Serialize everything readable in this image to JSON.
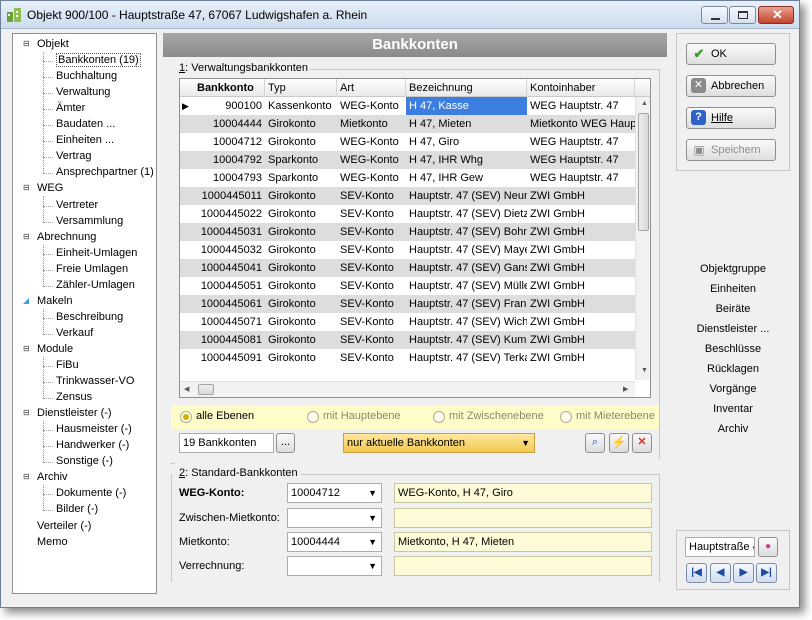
{
  "window": {
    "title": "Objekt 900/100 - Hauptstraße 47, 67067 Ludwigshafen a. Rhein",
    "min_icon": "minimize-icon",
    "max_icon": "maximize-icon",
    "close_icon": "close-icon"
  },
  "tree": [
    {
      "label": "Objekt",
      "level": 0,
      "icon": "minus"
    },
    {
      "label": "Bankkonten (19)",
      "level": 1,
      "selected": true
    },
    {
      "label": "Buchhaltung",
      "level": 1
    },
    {
      "label": "Verwaltung",
      "level": 1
    },
    {
      "label": "Ämter",
      "level": 1
    },
    {
      "label": "Baudaten ...",
      "level": 1
    },
    {
      "label": "Einheiten ...",
      "level": 1
    },
    {
      "label": "Vertrag",
      "level": 1
    },
    {
      "label": "Ansprechpartner (1)",
      "level": 1
    },
    {
      "label": "WEG",
      "level": 0,
      "icon": "minus"
    },
    {
      "label": "Vertreter",
      "level": 1
    },
    {
      "label": "Versammlung",
      "level": 1
    },
    {
      "label": "Abrechnung",
      "level": 0,
      "icon": "minus"
    },
    {
      "label": "Einheit-Umlagen",
      "level": 1
    },
    {
      "label": "Freie Umlagen",
      "level": 1
    },
    {
      "label": "Zähler-Umlagen",
      "level": 1
    },
    {
      "label": "Makeln",
      "level": 0,
      "icon": "open"
    },
    {
      "label": "Beschreibung",
      "level": 1
    },
    {
      "label": "Verkauf",
      "level": 1
    },
    {
      "label": "Module",
      "level": 0,
      "icon": "minus"
    },
    {
      "label": "FiBu",
      "level": 1
    },
    {
      "label": "Trinkwasser-VO",
      "level": 1
    },
    {
      "label": "Zensus",
      "level": 1
    },
    {
      "label": "Dienstleister (-)",
      "level": 0,
      "icon": "minus"
    },
    {
      "label": "Hausmeister (-)",
      "level": 1
    },
    {
      "label": "Handwerker (-)",
      "level": 1
    },
    {
      "label": "Sonstige (-)",
      "level": 1
    },
    {
      "label": "Archiv",
      "level": 0,
      "icon": "minus"
    },
    {
      "label": "Dokumente (-)",
      "level": 1
    },
    {
      "label": "Bilder (-)",
      "level": 1
    },
    {
      "label": "Verteiler (-)",
      "level": 0
    },
    {
      "label": "Memo",
      "level": 0
    }
  ],
  "main": {
    "title": "Bankkonten",
    "section1_num": "1",
    "section1_label": ": Verwaltungsbankkonten",
    "section2_num": "2",
    "section2_label": ": Standard-Bankkonten"
  },
  "grid": {
    "columns": [
      "Bankkonto",
      "Typ",
      "Art",
      "Bezeichnung",
      "Kontoinhaber"
    ],
    "rows": [
      [
        "900100",
        "Kassenkonto",
        "WEG-Konto",
        "H 47, Kasse",
        "WEG Hauptstr. 47"
      ],
      [
        "10004444",
        "Girokonto",
        "Mietkonto",
        "H 47, Mieten",
        "Mietkonto WEG Haup"
      ],
      [
        "10004712",
        "Girokonto",
        "WEG-Konto",
        "H 47, Giro",
        "WEG Hauptstr. 47"
      ],
      [
        "10004792",
        "Sparkonto",
        "WEG-Konto",
        "H 47, IHR Whg",
        "WEG Hauptstr. 47"
      ],
      [
        "10004793",
        "Sparkonto",
        "WEG-Konto",
        "H 47, IHR Gew",
        "WEG Hauptstr. 47"
      ],
      [
        "1000445011",
        "Girokonto",
        "SEV-Konto",
        "Hauptstr. 47 (SEV) Neum",
        "ZWI GmbH"
      ],
      [
        "1000445022",
        "Girokonto",
        "SEV-Konto",
        "Hauptstr. 47 (SEV) Dietz",
        "ZWI GmbH"
      ],
      [
        "1000445031",
        "Girokonto",
        "SEV-Konto",
        "Hauptstr. 47 (SEV) Bohn",
        "ZWI GmbH"
      ],
      [
        "1000445032",
        "Girokonto",
        "SEV-Konto",
        "Hauptstr. 47 (SEV) Maye",
        "ZWI GmbH"
      ],
      [
        "1000445041",
        "Girokonto",
        "SEV-Konto",
        "Hauptstr. 47 (SEV) Gans",
        "ZWI GmbH"
      ],
      [
        "1000445051",
        "Girokonto",
        "SEV-Konto",
        "Hauptstr. 47 (SEV) Mülle",
        "ZWI GmbH"
      ],
      [
        "1000445061",
        "Girokonto",
        "SEV-Konto",
        "Hauptstr. 47 (SEV) Frank",
        "ZWI GmbH"
      ],
      [
        "1000445071",
        "Girokonto",
        "SEV-Konto",
        "Hauptstr. 47 (SEV) Wich",
        "ZWI GmbH"
      ],
      [
        "1000445081",
        "Girokonto",
        "SEV-Konto",
        "Hauptstr. 47 (SEV) Kumn",
        "ZWI GmbH"
      ],
      [
        "1000445091",
        "Girokonto",
        "SEV-Konto",
        "Hauptstr. 47 (SEV) Terka",
        "ZWI GmbH"
      ]
    ],
    "row_indicator": "▶"
  },
  "filter": {
    "options": [
      "alle Ebenen",
      "mit Hauptebene",
      "mit Zwischenebene",
      "mit Mieterebene"
    ],
    "count_text": "19 Bankkonten",
    "ellipsis": "...",
    "combo_value": "nur aktuelle Bankkonten"
  },
  "standard": {
    "weg_label": "WEG-Konto:",
    "weg_value": "10004712",
    "weg_desc": "WEG-Konto,  H 47, Giro",
    "zwischen_label": "Zwischen-Mietkonto:",
    "zwischen_value": "",
    "zwischen_desc": "",
    "miet_label": "Mietkonto:",
    "miet_value": "10004444",
    "miet_desc": "Mietkonto,  H 47, Mieten",
    "verr_label": "Verrechnung:",
    "verr_value": "",
    "verr_desc": ""
  },
  "buttons": {
    "ok": "OK",
    "cancel": "Abbrechen",
    "help": "Hilfe",
    "save": "Speichern"
  },
  "links": [
    "Objektgruppe",
    "Einheiten",
    "Beiräte",
    "Dienstleister ...",
    "Beschlüsse",
    "Rücklagen",
    "Vorgänge",
    "Inventar",
    "Archiv"
  ],
  "nav": {
    "field_value": "Hauptstraße 4",
    "first": "|◀",
    "prev": "◀",
    "next": "▶",
    "last": "▶|"
  }
}
